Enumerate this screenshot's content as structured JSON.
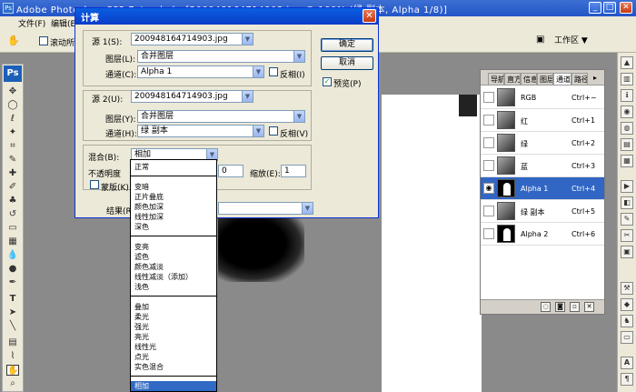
{
  "app": {
    "title": "Adobe Photoshop CS2 Extended - [200948164714903.jpg @ 100% (绿 副本, Alpha 1/8)]",
    "minimize": "_",
    "maximize": "□",
    "close": "✕"
  },
  "menubar": {
    "items": [
      "文件(F)",
      "编辑(E)"
    ]
  },
  "options": {
    "label": "滚动所有窗口",
    "workspace": "工作区 ▼"
  },
  "dialog": {
    "title": "计算",
    "close": "✕",
    "source1": {
      "label": "源 1(S):",
      "value": "200948164714903.jpg",
      "layer_label": "图层(L):",
      "layer_value": "合并图层",
      "channel_label": "通道(C):",
      "channel_value": "Alpha 1",
      "invert_label": "反相(I)"
    },
    "source2": {
      "label": "源 2(U):",
      "value": "200948164714903.jpg",
      "layer_label": "图层(Y):",
      "layer_value": "合并图层",
      "channel_label": "通道(H):",
      "channel_value": "绿 副本",
      "invert_label": "反相(V)"
    },
    "blend": {
      "label": "混合(B):",
      "value": "相加",
      "opacity_label": "不透明度",
      "opacity_value": "0",
      "scale_label": "缩放(E):",
      "scale_value": "1",
      "mask_label": "蒙版(K)..."
    },
    "result_label": "结果(R):",
    "ok": "确定",
    "cancel": "取消",
    "preview_label": "预览(P)"
  },
  "blend_options": {
    "groups": [
      [
        "正常"
      ],
      [
        "变暗",
        "正片叠底",
        "颜色加深",
        "线性加深",
        "深色"
      ],
      [
        "变亮",
        "滤色",
        "颜色减淡",
        "线性减淡（添加）",
        "浅色"
      ],
      [
        "叠加",
        "柔光",
        "强光",
        "亮光",
        "线性光",
        "点光",
        "实色混合"
      ],
      [
        "相加"
      ]
    ],
    "selected": "相加"
  },
  "channels_panel": {
    "tabs": [
      "导航",
      "直方",
      "信息",
      "图层",
      "通道",
      "路径"
    ],
    "active_tab": "通道",
    "channels": [
      {
        "name": "RGB",
        "shortcut": "Ctrl+~"
      },
      {
        "name": "红",
        "shortcut": "Ctrl+1"
      },
      {
        "name": "绿",
        "shortcut": "Ctrl+2"
      },
      {
        "name": "蓝",
        "shortcut": "Ctrl+3"
      },
      {
        "name": "Alpha 1",
        "shortcut": "Ctrl+4"
      },
      {
        "name": "绿 副本",
        "shortcut": "Ctrl+5"
      },
      {
        "name": "Alpha 2",
        "shortcut": "Ctrl+6"
      }
    ],
    "selected": "Alpha 1"
  },
  "toolbox": {
    "logo": "Ps"
  }
}
